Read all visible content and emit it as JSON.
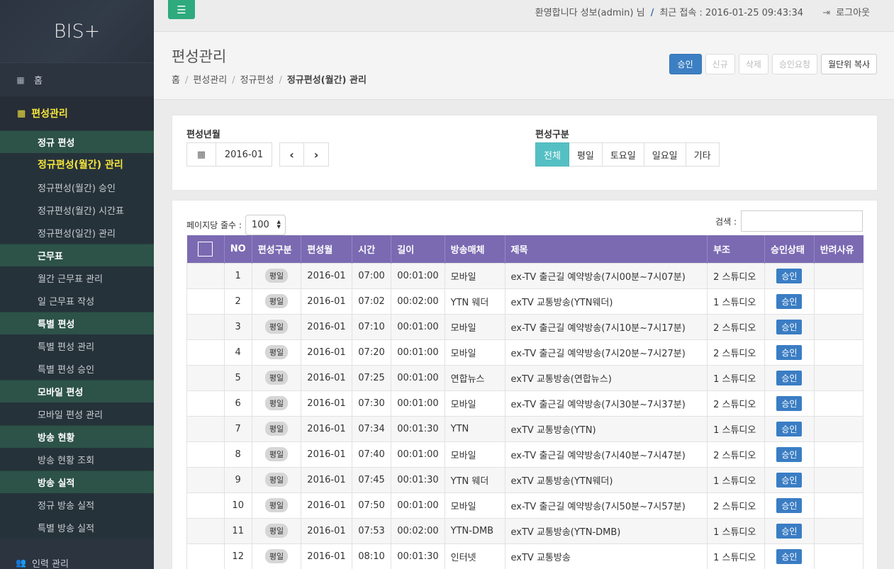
{
  "app": {
    "logo": "BIS+"
  },
  "topbar": {
    "welcome": "환영합니다 성보(admin) 님",
    "divider": "/",
    "last_login": "최근 접속 : 2016-01-25 09:43:34",
    "logout": "로그아웃"
  },
  "sidebar": {
    "home": "홈",
    "group": "편성관리",
    "items": [
      {
        "label": "정규 편성",
        "type": "section"
      },
      {
        "label": "정규편성(월간) 관리",
        "type": "active"
      },
      {
        "label": "정규편성(월간) 승인",
        "type": "sub"
      },
      {
        "label": "정규편성(월간) 시간표",
        "type": "sub"
      },
      {
        "label": "정규편성(일간) 관리",
        "type": "sub"
      },
      {
        "label": "근무표",
        "type": "section"
      },
      {
        "label": "월간 근무표 관리",
        "type": "sub"
      },
      {
        "label": "일 근무표 작성",
        "type": "sub"
      },
      {
        "label": "특별 편성",
        "type": "section"
      },
      {
        "label": "특별 편성 관리",
        "type": "sub"
      },
      {
        "label": "특별 편성 승인",
        "type": "sub"
      },
      {
        "label": "모바일 편성",
        "type": "section"
      },
      {
        "label": "모바일 편성 관리",
        "type": "sub"
      },
      {
        "label": "방송 현황",
        "type": "section"
      },
      {
        "label": "방송 현황 조회",
        "type": "sub"
      },
      {
        "label": "방송 실적",
        "type": "section"
      },
      {
        "label": "정규 방송 실적",
        "type": "sub"
      },
      {
        "label": "특별 방송 실적",
        "type": "sub"
      }
    ],
    "bottom": "인력 관리"
  },
  "page": {
    "title": "편성관리",
    "breadcrumb": [
      "홈",
      "편성관리",
      "정규편성",
      "정규편성(월간) 관리"
    ],
    "actions": {
      "approve": "승인",
      "new": "신규",
      "delete": "삭제",
      "request": "승인요청",
      "copy": "월단위 복사"
    }
  },
  "filter": {
    "month_label": "편성년월",
    "month_value": "2016-01",
    "type_label": "편성구분",
    "types": [
      "전체",
      "평일",
      "토요일",
      "일요일",
      "기타"
    ],
    "selected_type": "전체"
  },
  "list": {
    "page_size_label": "페이지당 줄수 :",
    "page_size": "100",
    "search_label": "검색 :",
    "search_value": "",
    "columns": [
      "NO",
      "편성구분",
      "편성월",
      "시간",
      "길이",
      "방송매체",
      "제목",
      "부조",
      "승인상태",
      "반려사유"
    ],
    "rows": [
      [
        "1",
        "평일",
        "2016-01",
        "07:00",
        "00:01:00",
        "모바일",
        "ex-TV 출근길 예약방송(7시00분~7시07분)",
        "2 스튜디오",
        "승인",
        ""
      ],
      [
        "2",
        "평일",
        "2016-01",
        "07:02",
        "00:02:00",
        "YTN 웨더",
        "exTV 교통방송(YTN웨더)",
        "1 스튜디오",
        "승인",
        ""
      ],
      [
        "3",
        "평일",
        "2016-01",
        "07:10",
        "00:01:00",
        "모바일",
        "ex-TV 출근길 예약방송(7시10분~7시17분)",
        "2 스튜디오",
        "승인",
        ""
      ],
      [
        "4",
        "평일",
        "2016-01",
        "07:20",
        "00:01:00",
        "모바일",
        "ex-TV 출근길 예약방송(7시20분~7시27분)",
        "2 스튜디오",
        "승인",
        ""
      ],
      [
        "5",
        "평일",
        "2016-01",
        "07:25",
        "00:01:00",
        "연합뉴스",
        "exTV 교통방송(연합뉴스)",
        "1 스튜디오",
        "승인",
        ""
      ],
      [
        "6",
        "평일",
        "2016-01",
        "07:30",
        "00:01:00",
        "모바일",
        "ex-TV 출근길 예약방송(7시30분~7시37분)",
        "2 스튜디오",
        "승인",
        ""
      ],
      [
        "7",
        "평일",
        "2016-01",
        "07:34",
        "00:01:30",
        "YTN",
        "exTV 교통방송(YTN)",
        "1 스튜디오",
        "승인",
        ""
      ],
      [
        "8",
        "평일",
        "2016-01",
        "07:40",
        "00:01:00",
        "모바일",
        "ex-TV 출근길 예약방송(7시40분~7시47분)",
        "2 스튜디오",
        "승인",
        ""
      ],
      [
        "9",
        "평일",
        "2016-01",
        "07:45",
        "00:01:30",
        "YTN 웨더",
        "exTV 교통방송(YTN웨더)",
        "1 스튜디오",
        "승인",
        ""
      ],
      [
        "10",
        "평일",
        "2016-01",
        "07:50",
        "00:01:00",
        "모바일",
        "ex-TV 출근길 예약방송(7시50분~7시57분)",
        "2 스튜디오",
        "승인",
        ""
      ],
      [
        "11",
        "평일",
        "2016-01",
        "07:53",
        "00:02:00",
        "YTN-DMB",
        "exTV 교통방송(YTN-DMB)",
        "1 스튜디오",
        "승인",
        ""
      ],
      [
        "12",
        "평일",
        "2016-01",
        "08:10",
        "00:01:30",
        "인터넷",
        "exTV 교통방송",
        "1 스튜디오",
        "승인",
        ""
      ]
    ]
  },
  "colors": {
    "header": "#7b6ab2",
    "accent": "#3c7fc3",
    "toggle": "#2eaa7e",
    "active_seg": "#55c0c4",
    "nav_active": "#f5e53b"
  },
  "icons": {
    "menu": "bars-icon",
    "home": "grid-icon",
    "group": "calendar-icon",
    "logout": "signout-icon",
    "people": "users-icon"
  }
}
